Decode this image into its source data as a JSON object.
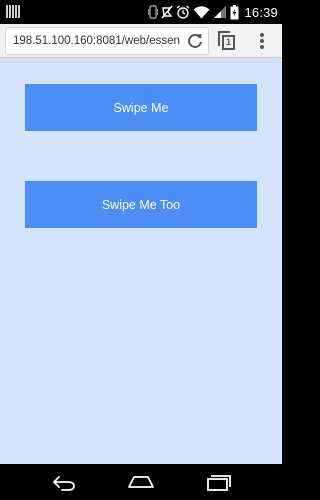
{
  "status_bar": {
    "time": "16:39"
  },
  "browser": {
    "url": "198.51.100.160:8081/web/essen",
    "tab_count": "1"
  },
  "page": {
    "buttons": [
      {
        "label": "Swipe Me"
      },
      {
        "label": "Swipe Me Too"
      }
    ]
  },
  "colors": {
    "page_background": "#d2e3fb",
    "button_background": "#4d8df6",
    "button_text": "#ffffff",
    "system_bars": "#000000"
  },
  "icons": {
    "status": [
      "notification-icon",
      "vibrate-icon",
      "do-not-disturb-icon",
      "alarm-icon",
      "wifi-icon",
      "signal-icon",
      "battery-icon"
    ],
    "toolbar": [
      "reload-icon",
      "tabs-icon",
      "overflow-menu-icon"
    ],
    "navigation": [
      "back-icon",
      "home-icon",
      "recent-apps-icon"
    ]
  }
}
